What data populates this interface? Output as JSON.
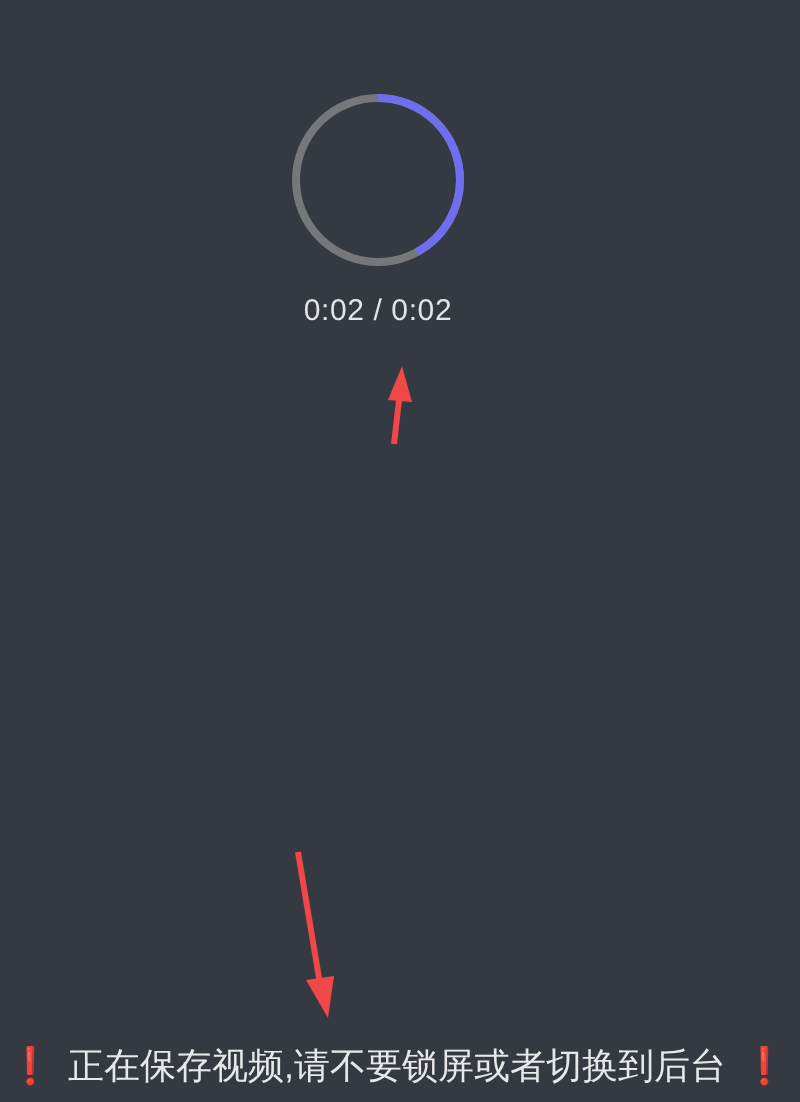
{
  "progress": {
    "level": 0.42
  },
  "time": "0:02 / 0:02",
  "warning": {
    "icon_left": "❗",
    "text": "正在保存视频,请不要锁屏或者切换到后台",
    "icon_right": "❗"
  }
}
